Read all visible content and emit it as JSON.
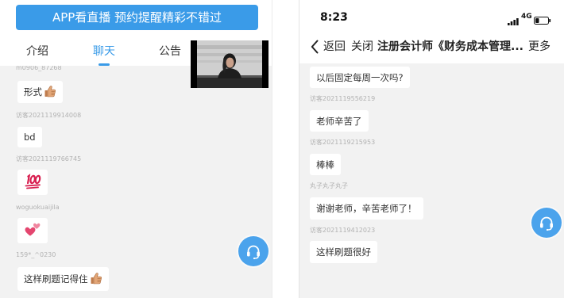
{
  "colors": {
    "accent": "#3a9be8",
    "support_button": "#4ba3ec",
    "chat_background": "#f2f2f2"
  },
  "left": {
    "banner_button": "APP看直播 预约提醒精彩不错过",
    "tabs": [
      {
        "label": "介绍",
        "active": false
      },
      {
        "label": "聊天",
        "active": true
      },
      {
        "label": "公告",
        "active": false
      }
    ],
    "chat": [
      {
        "sender": "m0906_87268",
        "text": "形式",
        "emoji": "thumbs-up-icon"
      },
      {
        "sender": "访客2021119914008",
        "text": "bd"
      },
      {
        "sender": "访客2021119766745",
        "emoji": "hundred-points-icon"
      },
      {
        "sender": "woguokuaijila",
        "emoji": "two-hearts-icon"
      },
      {
        "sender": "159*_^0230",
        "text": "这样刷题记得住",
        "emoji": "thumbs-up-icon"
      }
    ],
    "support_button_icon": "headset-icon"
  },
  "right": {
    "status_bar": {
      "time": "8:23",
      "network": "4G",
      "battery_level": 0.3
    },
    "header": {
      "back_label": "返回",
      "close_label": "关闭",
      "title": "注册会计师《财务成本管理...",
      "more_label": "更多"
    },
    "chat": [
      {
        "text": "以后固定每周一次吗?"
      },
      {
        "sender": "访客2021119556219",
        "text": "老师辛苦了"
      },
      {
        "sender": "访客2021119215953",
        "text": "棒棒"
      },
      {
        "sender": "丸子丸子丸子",
        "text": "谢谢老师，辛苦老师了！"
      },
      {
        "sender": "访客2021119412023",
        "text": "这样刷题很好"
      }
    ],
    "support_button_icon": "headset-icon"
  }
}
